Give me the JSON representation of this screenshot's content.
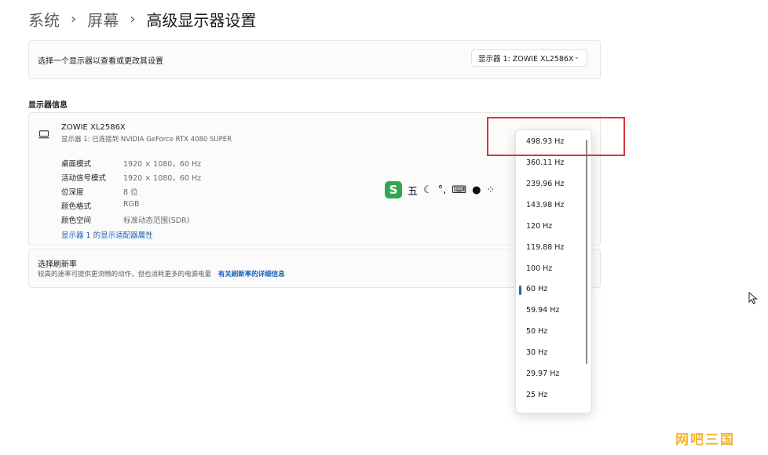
{
  "breadcrumb": {
    "items": [
      "系统",
      "屏幕"
    ],
    "current": "高级显示器设置",
    "separator": "›"
  },
  "display_select": {
    "label": "选择一个显示器以查看或更改其设置",
    "value": "显示器 1: ZOWIE XL2586X"
  },
  "display_info": {
    "section_title": "显示器信息",
    "monitor_name": "ZOWIE XL2586X",
    "monitor_sub": "显示器 1: 已连接到 NVIDIA GeForce RTX 4080 SUPER",
    "rows": [
      {
        "label": "桌面模式",
        "value": "1920 × 1080，60 Hz"
      },
      {
        "label": "活动信号模式",
        "value": "1920 × 1080，60 Hz"
      },
      {
        "label": "位深度",
        "value": "8 位"
      },
      {
        "label": "颜色格式",
        "value": "RGB"
      },
      {
        "label": "颜色空间",
        "value": "标准动态范围(SDR)"
      }
    ],
    "adapter_link": "显示器 1 的显示适配器属性"
  },
  "refresh": {
    "title": "选择刷新率",
    "desc": "较高的速率可提供更流畅的动作，但也消耗更多的电源电量",
    "link": "有关刷新率的详细信息"
  },
  "dropdown": {
    "options": [
      "498.93 Hz",
      "360.11 Hz",
      "239.96 Hz",
      "143.98 Hz",
      "120 Hz",
      "119.88 Hz",
      "100 Hz",
      "60 Hz",
      "59.94 Hz",
      "50 Hz",
      "30 Hz",
      "29.97 Hz",
      "25 Hz"
    ],
    "selected": "60 Hz"
  },
  "ime_toolbar": {
    "logo": "S",
    "mode": "五",
    "punct": "°,"
  },
  "watermark": "网吧三国",
  "colors": {
    "accent": "#0f6cbd",
    "link": "#1a5fb4",
    "highlight_box": "#e0323a",
    "ime_green": "#2fa84f",
    "watermark": "#f3b233"
  }
}
